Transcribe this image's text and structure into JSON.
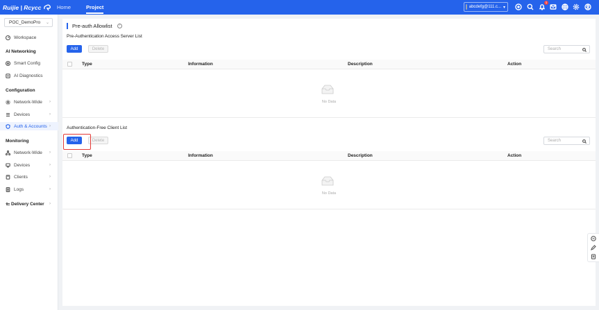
{
  "header": {
    "logo_text": "Ruijie | Rcycc",
    "nav": [
      {
        "label": "Home"
      },
      {
        "label": "Project"
      }
    ],
    "account_label": "abcdefg@111.c...",
    "notification_count": "1"
  },
  "sidebar": {
    "project_select": "POC_DemoPro",
    "workspace": "Workspace",
    "ai_networking": {
      "heading": "AI Networking",
      "items": [
        {
          "label": "Smart Config"
        },
        {
          "label": "AI Diagnostics"
        }
      ]
    },
    "configuration": {
      "heading": "Configuration",
      "items": [
        {
          "label": "Network-Wide"
        },
        {
          "label": "Devices"
        },
        {
          "label": "Auth & Accounts"
        }
      ]
    },
    "monitoring": {
      "heading": "Monitoring",
      "items": [
        {
          "label": "Network-Wide"
        },
        {
          "label": "Devices"
        },
        {
          "label": "Clients"
        },
        {
          "label": "Logs"
        }
      ]
    },
    "delivery_center": "Delivery Center",
    "active_item": "Auth & Accounts"
  },
  "main": {
    "page_title": "Pre-auth Allowlist",
    "sections": [
      {
        "title": "Pre-Authentication Access Server List",
        "add_label": "Add",
        "delete_label": "Delete",
        "search_placeholder": "Search",
        "columns": [
          "Type",
          "Information",
          "Description",
          "Action"
        ],
        "empty_text": "No Data"
      },
      {
        "title": "Authentication-Free Client List",
        "add_label": "Add",
        "delete_label": "Delete",
        "search_placeholder": "Search",
        "columns": [
          "Type",
          "Information",
          "Description",
          "Action"
        ],
        "empty_text": "No Data"
      }
    ]
  },
  "colors": {
    "brand": "#2563eb",
    "highlight": "#e53935"
  }
}
